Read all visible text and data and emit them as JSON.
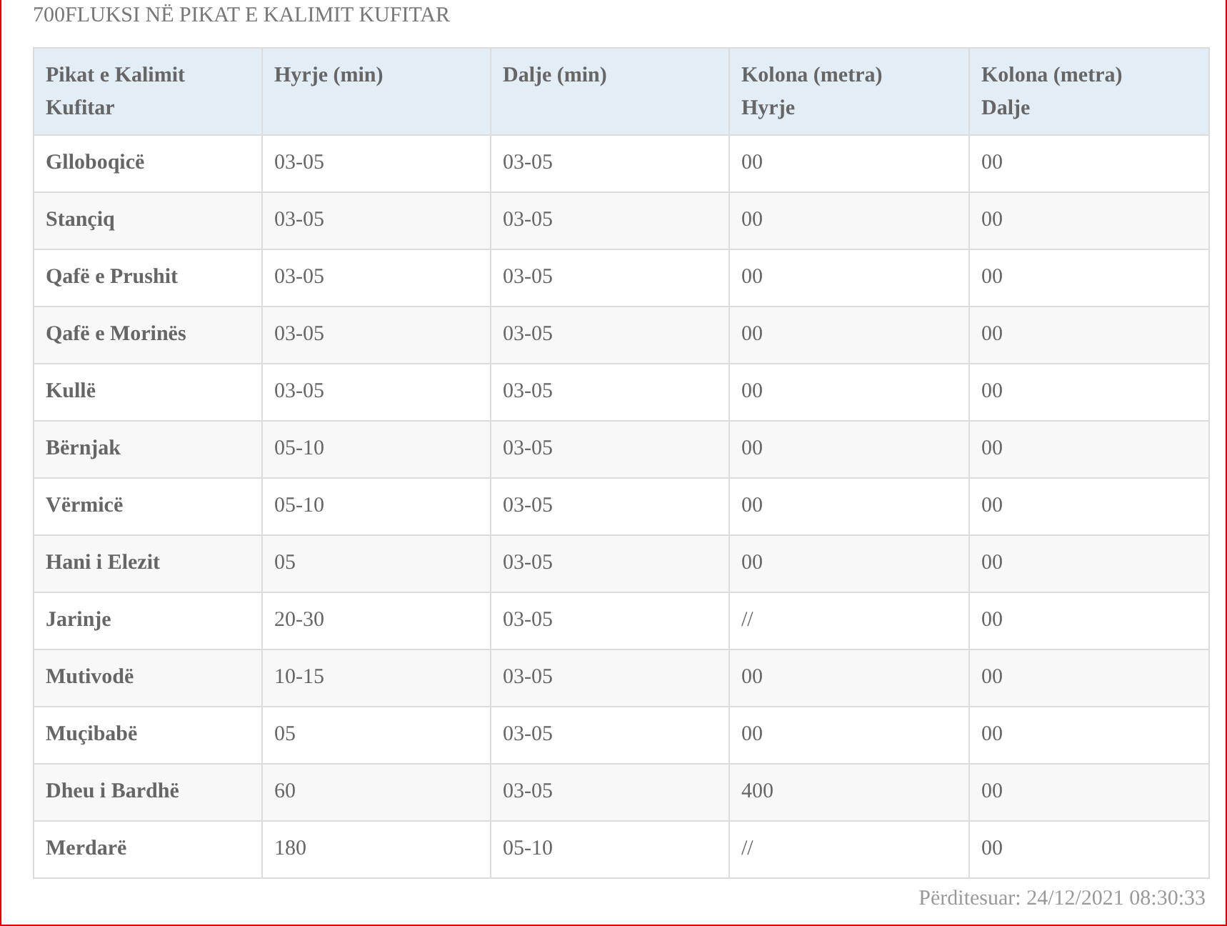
{
  "title": "700FLUKSI NË PIKAT E KALIMIT KUFITAR",
  "table": {
    "columns": [
      "Pikat e Kalimit Kufitar",
      "Hyrje (min)",
      "Dalje (min)",
      "Kolona (metra) Hyrje",
      "Kolona (metra) Dalje"
    ],
    "rows": [
      [
        "Glloboqicë",
        "03-05",
        "03-05",
        "00",
        "00"
      ],
      [
        "Stançiq",
        "03-05",
        "03-05",
        "00",
        "00"
      ],
      [
        "Qafë e Prushit",
        "03-05",
        "03-05",
        "00",
        "00"
      ],
      [
        "Qafë e Morinës",
        "03-05",
        "03-05",
        "00",
        "00"
      ],
      [
        "Kullë",
        "03-05",
        "03-05",
        "00",
        "00"
      ],
      [
        "Bërnjak",
        "05-10",
        "03-05",
        "00",
        "00"
      ],
      [
        "Vërmicë",
        "05-10",
        "03-05",
        "00",
        "00"
      ],
      [
        "Hani i Elezit",
        "05",
        "03-05",
        "00",
        "00"
      ],
      [
        "Jarinje",
        "20-30",
        "03-05",
        "//",
        "00"
      ],
      [
        "Mutivodë",
        "10-15",
        "03-05",
        "00",
        "00"
      ],
      [
        "Muçibabë",
        "05",
        "03-05",
        "00",
        "00"
      ],
      [
        "Dheu i Bardhë",
        "60",
        "03-05",
        "400",
        "00"
      ],
      [
        "Merdarë",
        "180",
        "05-10",
        "//",
        "00"
      ]
    ]
  },
  "updated": "Përditesuar: 24/12/2021 08:30:33"
}
